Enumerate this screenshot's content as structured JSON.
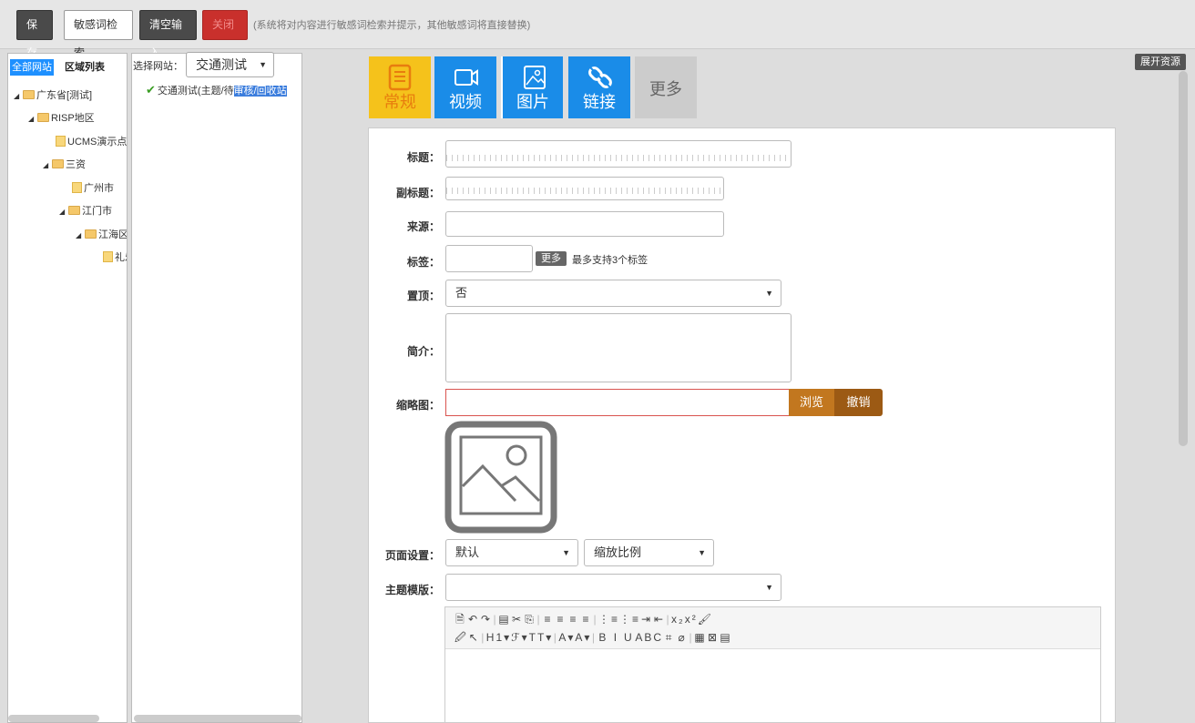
{
  "toolbar": {
    "save": "保存",
    "sensitive": "敏感词检索",
    "clear": "清空输入",
    "close": "关闭",
    "note": "(系统将对内容进行敏感词检索并提示，其他敏感词将直接替换)"
  },
  "leftPanel": {
    "tab_all": "全部网站",
    "tab_region": "区域列表",
    "tree": [
      {
        "label": "广东省[测试]",
        "type": "folder",
        "expanded": true
      },
      {
        "label": "RISP地区",
        "type": "folder",
        "expanded": true
      },
      {
        "label": "UCMS演示点",
        "type": "file"
      },
      {
        "label": "三资",
        "type": "folder",
        "expanded": true
      },
      {
        "label": "广州市",
        "type": "file"
      },
      {
        "label": "江门市",
        "type": "folder",
        "expanded": true
      },
      {
        "label": "江海区",
        "type": "folder",
        "expanded": true
      },
      {
        "label": "礼乐",
        "type": "file"
      }
    ]
  },
  "sitePanel": {
    "label": "选择网站：",
    "selected": "交通测试",
    "item_prefix": "交通测试(主题/待",
    "item_highlight": "审核/回收站"
  },
  "expand": "展开资源",
  "tabs": [
    {
      "label": "常规",
      "icon": "document-icon",
      "color": "#f5c21b",
      "labelColor": "#e87d0e"
    },
    {
      "label": "视频",
      "icon": "video-icon",
      "color": "#1a8ce8"
    },
    {
      "label": "图片",
      "icon": "image-icon",
      "color": "#1a8ce8"
    },
    {
      "label": "链接",
      "icon": "link-icon",
      "color": "#1a8ce8"
    },
    {
      "label": "更多",
      "icon": "",
      "color": "#cccccc"
    }
  ],
  "form": {
    "title_label": "标题：",
    "subtitle_label": "副标题：",
    "source_label": "来源：",
    "tags_label": "标签：",
    "tags_more": "更多",
    "tags_note": "最多支持3个标签",
    "top_label": "置顶：",
    "top_value": "否",
    "summary_label": "简介：",
    "thumb_label": "缩略图：",
    "browse": "浏览",
    "cancel": "撤销",
    "page_label": "页面设置：",
    "page_value": "默认",
    "scale_value": "缩放比例",
    "template_label": "主题模版："
  },
  "editor": {
    "row1": [
      "🗎",
      "↶",
      "↷",
      "|",
      "▤",
      "✂",
      "⎘",
      "|",
      "≡",
      "≡",
      "≡",
      "≡",
      "|",
      "⋮≡",
      "⋮≡",
      "⇥",
      "⇤",
      "|",
      "x₂",
      "x²",
      "🖌"
    ],
    "row2": [
      "🖉",
      "↖",
      "|",
      "H1▾",
      "ℱ▾",
      "TT▾",
      "|",
      "A▾",
      "A▾",
      "|",
      "B",
      "I",
      "U",
      "ABC",
      "⌗",
      "⌀",
      "|",
      "▦",
      "⊠",
      "▤"
    ]
  }
}
